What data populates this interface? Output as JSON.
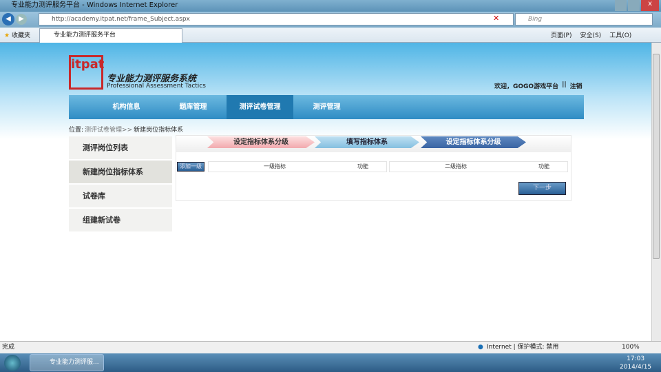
{
  "browser": {
    "title": "专业能力测评服务平台 - Windows Internet Explorer",
    "url": "http://academy.itpat.net/frame_Subject.aspx",
    "search_placeholder": "Bing",
    "favorites": "收藏夹",
    "tab": "专业能力测评服务平台",
    "menu": [
      "页面(P)",
      "安全(S)",
      "工具(O)"
    ]
  },
  "header": {
    "title": "专业能力测评服务系统",
    "subtitle": "Professional Assessment Tactics",
    "welcome": "欢迎，GOGO游戏平台",
    "separator": "||",
    "logout": "注销"
  },
  "nav": [
    "机构信息",
    "题库管理",
    "测评试卷管理",
    "测评管理"
  ],
  "breadcrumb": {
    "label": "位置:",
    "path": "测评试卷管理>>",
    "current": "新建岗位指标体系"
  },
  "sidebar": [
    "测评岗位列表",
    "新建岗位指标体系",
    "试卷库",
    "组建新试卷"
  ],
  "steps": [
    "设定指标体系分级",
    "填写指标体系",
    "设定指标体系分级"
  ],
  "table": {
    "add_button": "添加一级",
    "col1": "一级指标",
    "col2": "功能",
    "col3": "二级指标",
    "col4": "功能"
  },
  "next_button": "下一步",
  "status": {
    "left": "完成",
    "zone": "Internet | 保护模式: 禁用",
    "zoom": "100%"
  },
  "taskbar": {
    "task": "专业能力测评服...",
    "time": "17:03",
    "date": "2014/4/15"
  }
}
